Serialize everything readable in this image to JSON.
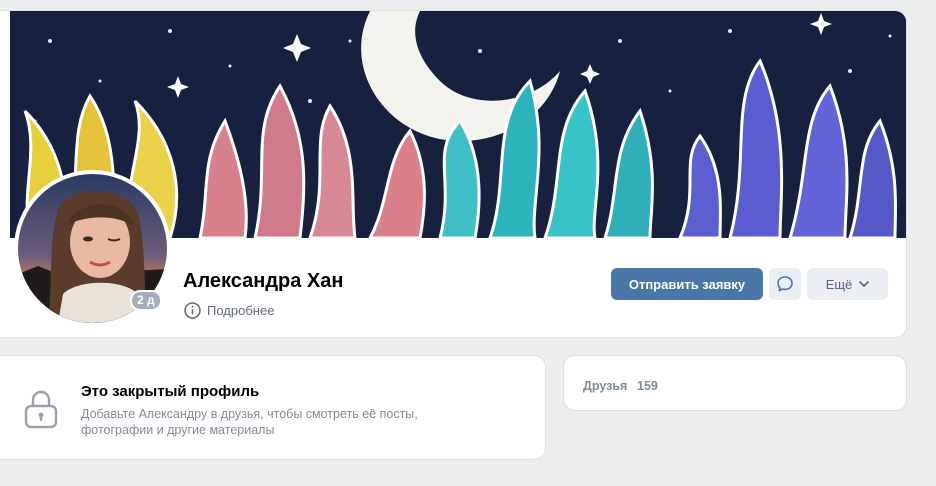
{
  "profile": {
    "name": "Александра Хан",
    "more_label": "Подробнее",
    "online_badge": "2 д",
    "cover_alt": "cover-image",
    "avatar_alt": "profile-photo"
  },
  "actions": {
    "send_request_label": "Отправить заявку",
    "more_menu_label": "Ещё"
  },
  "private_profile": {
    "title": "Это закрытый профиль",
    "description": "Добавьте Александру в друзья, чтобы смотреть её посты, фотографии и другие материалы"
  },
  "friends": {
    "label": "Друзья",
    "count": "159"
  },
  "colors": {
    "accent": "#4a76a8",
    "secondary_button": "#ebeef2",
    "page_background": "#edeef0",
    "muted_text": "#818c99"
  },
  "icons": [
    "info-icon",
    "message-icon",
    "chevron-down-icon",
    "lock-icon"
  ]
}
